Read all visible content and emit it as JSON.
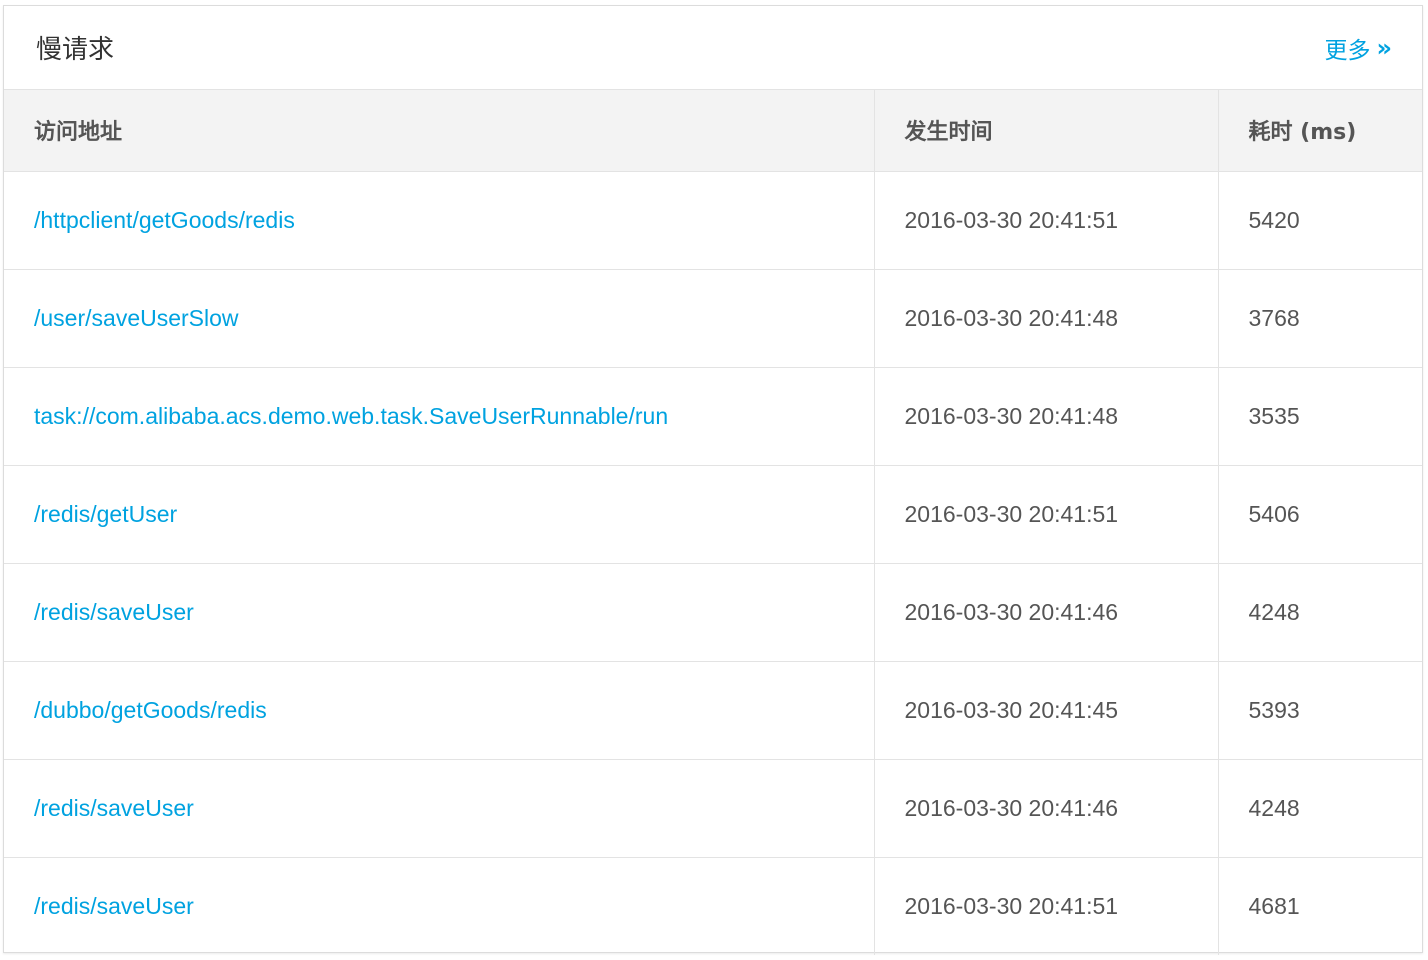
{
  "panel": {
    "title": "慢请求",
    "more_label": "更多",
    "more_arrow": "»"
  },
  "table": {
    "headers": [
      "访问地址",
      "发生时间",
      "耗时 (ms)"
    ],
    "rows": [
      {
        "url": "/httpclient/getGoods/redis",
        "time": "2016-03-30 20:41:51",
        "duration": "5420"
      },
      {
        "url": "/user/saveUserSlow",
        "time": "2016-03-30 20:41:48",
        "duration": "3768"
      },
      {
        "url": "task://com.alibaba.acs.demo.web.task.SaveUserRunnable/run",
        "time": "2016-03-30 20:41:48",
        "duration": "3535"
      },
      {
        "url": "/redis/getUser",
        "time": "2016-03-30 20:41:51",
        "duration": "5406"
      },
      {
        "url": "/redis/saveUser",
        "time": "2016-03-30 20:41:46",
        "duration": "4248"
      },
      {
        "url": "/dubbo/getGoods/redis",
        "time": "2016-03-30 20:41:45",
        "duration": "5393"
      },
      {
        "url": "/redis/saveUser",
        "time": "2016-03-30 20:41:46",
        "duration": "4248"
      },
      {
        "url": "/redis/saveUser",
        "time": "2016-03-30 20:41:51",
        "duration": "4681"
      }
    ]
  },
  "colors": {
    "link": "#00a2e0",
    "header_bg": "#f3f3f3",
    "border": "#e3e3e3"
  }
}
